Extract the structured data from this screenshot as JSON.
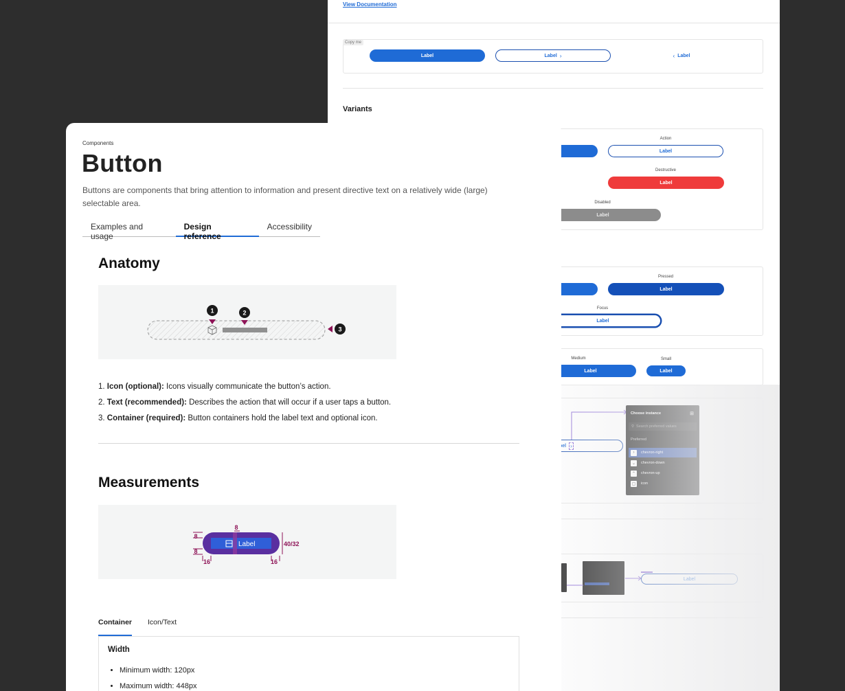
{
  "back_panel": {
    "view_doc_link": "View Documentation",
    "copy_tag": "Copy me",
    "top_buttons": [
      "Label",
      "Label",
      "Label"
    ],
    "variants_heading": "Variants",
    "variants": {
      "action_caption": "Action",
      "action_label": "Label",
      "destructive_caption": "Destructive",
      "destructive_label": "Label",
      "disabled_caption": "Disabled",
      "disabled_label": "Label"
    },
    "states": {
      "pressed_caption": "Pressed",
      "pressed_label": "Label",
      "focus_caption": "Focus",
      "focus_label": "Label"
    },
    "sizes": {
      "medium_caption": "Medium",
      "medium_label": "Label",
      "small_caption": "Small",
      "small_label": "Label"
    },
    "instance_swap": {
      "partial_label": "bel",
      "chooser_title": "Choose instance",
      "search_placeholder": "Search preferred values",
      "preferred_label": "Preferred",
      "items": [
        "chevron-right",
        "chevron-down",
        "chevron-up",
        "icon"
      ]
    },
    "bottom_button_label": "Label"
  },
  "front_panel": {
    "breadcrumb": "Components",
    "title": "Button",
    "description": "Buttons are components that bring attention to information and present directive text on a relatively wide (large) selectable area.",
    "tabs": [
      "Examples and usage",
      "Design reference",
      "Accessibility"
    ],
    "active_tab": "Design reference",
    "anatomy": {
      "heading": "Anatomy",
      "markers": [
        "1",
        "2",
        "3"
      ],
      "list": [
        {
          "num": "1.",
          "term": "Icon (optional):",
          "desc": " Icons visually communicate the button’s action."
        },
        {
          "num": "2.",
          "term": "Text (recommended):",
          "desc": " Describes the action that will occur if a user taps a button."
        },
        {
          "num": "3.",
          "term": "Container (required):",
          "desc": " Button containers hold the label text and optional icon."
        }
      ]
    },
    "measurements": {
      "heading": "Measurements",
      "button_label": "Label",
      "top_gap": "8",
      "pad_top": "8",
      "pad_bottom": "8",
      "left_pad": "16",
      "right_pad": "16",
      "height": "40/32"
    },
    "subtabs": [
      "Container",
      "Icon/Text"
    ],
    "active_subtab": "Container",
    "width": {
      "title": "Width",
      "items": [
        "Minimum width: 120px",
        "Maximum width: 448px"
      ]
    }
  },
  "colors": {
    "primary": "#1f6bd6",
    "pressed": "#1450b8",
    "destructive": "#ef3b3b",
    "disabled": "#8c8c8c",
    "annotation": "#8e1457",
    "measure_overlay": "#5a2fa0"
  }
}
